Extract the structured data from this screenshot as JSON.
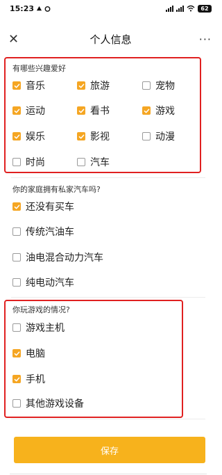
{
  "status": {
    "time": "15:23",
    "battery": "62"
  },
  "nav": {
    "title": "个人信息",
    "close_glyph": "✕",
    "more_glyph": "···"
  },
  "hobbies": {
    "title": "有哪些兴趣爱好",
    "options": [
      {
        "label": "音乐",
        "checked": true
      },
      {
        "label": "旅游",
        "checked": true
      },
      {
        "label": "宠物",
        "checked": false
      },
      {
        "label": "运动",
        "checked": true
      },
      {
        "label": "看书",
        "checked": true
      },
      {
        "label": "游戏",
        "checked": true
      },
      {
        "label": "娱乐",
        "checked": true
      },
      {
        "label": "影视",
        "checked": true
      },
      {
        "label": "动漫",
        "checked": false
      },
      {
        "label": "时尚",
        "checked": false
      },
      {
        "label": "汽车",
        "checked": false
      }
    ]
  },
  "car": {
    "title": "你的家庭拥有私家汽车吗?",
    "options": [
      {
        "label": "还没有买车",
        "checked": true
      },
      {
        "label": "传统汽油车",
        "checked": false
      },
      {
        "label": "油电混合动力汽车",
        "checked": false
      },
      {
        "label": "纯电动汽车",
        "checked": false
      }
    ]
  },
  "gaming": {
    "title": "你玩游戏的情况?",
    "options": [
      {
        "label": "游戏主机",
        "checked": false
      },
      {
        "label": "电脑",
        "checked": true
      },
      {
        "label": "手机",
        "checked": true
      },
      {
        "label": "其他游戏设备",
        "checked": false
      }
    ]
  },
  "save_label": "保存",
  "colors": {
    "accent": "#f5a623",
    "button": "#f7b21c",
    "highlight": "#e02020"
  }
}
